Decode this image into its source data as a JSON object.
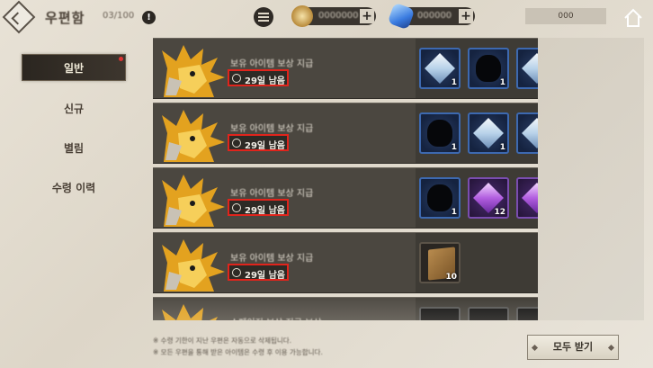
{
  "header": {
    "title": "우편함",
    "subtitle": "03/100",
    "info_glyph": "!",
    "currencies": [
      {
        "icon": "gold-coin-icon",
        "amount": "0000000"
      },
      {
        "icon": "blue-crystal-icon",
        "amount": "000000"
      }
    ],
    "plus_glyph": "+",
    "right_label": "000"
  },
  "sidebar": {
    "tabs": [
      {
        "label": "일반",
        "active": true
      },
      {
        "label": "신규",
        "active": false
      },
      {
        "label": "별림",
        "active": false
      },
      {
        "label": "수령 이력",
        "active": false
      }
    ]
  },
  "mail": {
    "rows": [
      {
        "name": "보유 아이템 보상 지급",
        "timer": "29일 남음",
        "rewards": [
          {
            "type": "gem",
            "count": "1"
          },
          {
            "type": "dark",
            "count": "1"
          },
          {
            "type": "gem",
            "count": ""
          }
        ]
      },
      {
        "name": "보유 아이템 보상 지급",
        "timer": "29일 남음",
        "rewards": [
          {
            "type": "dark",
            "count": "1"
          },
          {
            "type": "gem",
            "count": "1"
          },
          {
            "type": "gem",
            "count": ""
          }
        ]
      },
      {
        "name": "보유 아이템 보상 지급",
        "timer": "29일 남음",
        "rewards": [
          {
            "type": "dark",
            "count": "1"
          },
          {
            "type": "purple",
            "count": "12"
          },
          {
            "type": "purple",
            "count": ""
          }
        ]
      },
      {
        "name": "보유 아이템 보상 지급",
        "timer": "29일 남음",
        "rewards": [
          {
            "type": "book",
            "count": "10"
          }
        ]
      },
      {
        "name": "스페이지 보상 지급 보상",
        "timer": "",
        "rewards": [
          {
            "type": "black",
            "count": ""
          },
          {
            "type": "black",
            "count": ""
          },
          {
            "type": "black",
            "count": ""
          }
        ]
      }
    ]
  },
  "footer": {
    "notes": [
      "※ 수령 기한이 지난 우편은 자동으로 삭제됩니다.",
      "※ 모든 우편을 통해 받은 아이템은 수령 후 이용 가능합니다."
    ],
    "claim_all_label": "모두 받기"
  },
  "colors": {
    "background": "#e8e2d6",
    "row": "#4b4740",
    "timer_border": "#e0241c",
    "item_border_blue": "#3d69b0",
    "item_border_purple": "#7a4db0"
  }
}
